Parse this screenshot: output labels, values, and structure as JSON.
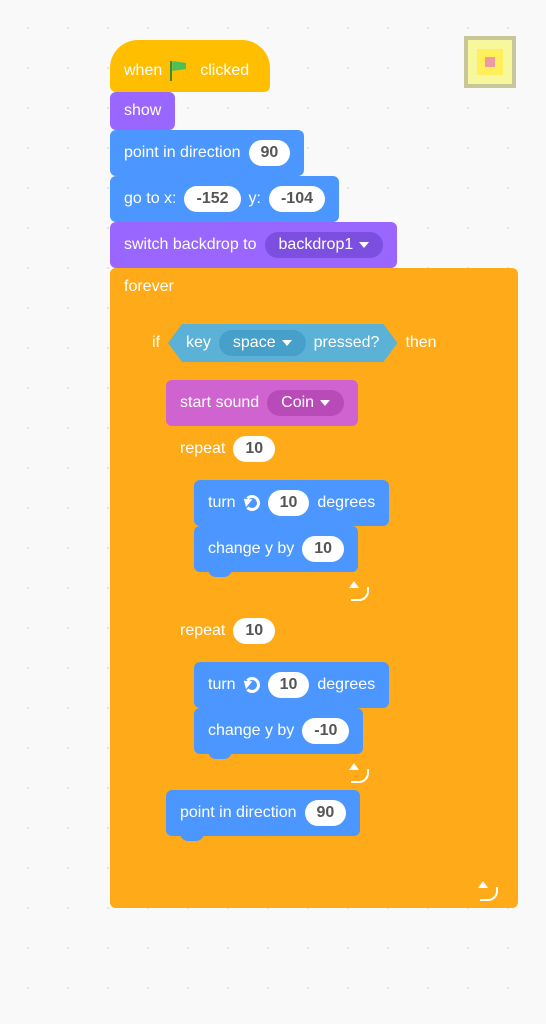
{
  "colors": {
    "events": "#ffbf00",
    "looks": "#9966ff",
    "motion": "#4c97ff",
    "control": "#ffab19",
    "sound": "#cf63cf",
    "sensing": "#5cb1d6"
  },
  "stop_button": {
    "name": "stop-button"
  },
  "script": {
    "hat": {
      "prefix": "when",
      "suffix": "clicked",
      "icon": "green-flag"
    },
    "show": {
      "label": "show"
    },
    "point1": {
      "label_pre": "point in direction",
      "value": "90"
    },
    "goto": {
      "label_pre": "go to x:",
      "x": "-152",
      "label_mid": "y:",
      "y": "-104"
    },
    "backdrop": {
      "label_pre": "switch backdrop to",
      "value": "backdrop1"
    },
    "forever": {
      "label": "forever"
    },
    "if": {
      "label_if": "if",
      "label_then": "then",
      "cond": {
        "pre": "key",
        "key": "space",
        "post": "pressed?"
      }
    },
    "sound": {
      "label_pre": "start sound",
      "value": "Coin"
    },
    "repeat1": {
      "label": "repeat",
      "count": "10",
      "turn": {
        "pre": "turn",
        "deg": "10",
        "post": "degrees"
      },
      "changeY": {
        "pre": "change y by",
        "val": "10"
      }
    },
    "repeat2": {
      "label": "repeat",
      "count": "10",
      "turn": {
        "pre": "turn",
        "deg": "10",
        "post": "degrees"
      },
      "changeY": {
        "pre": "change y by",
        "val": "-10"
      }
    },
    "point2": {
      "label_pre": "point in direction",
      "value": "90"
    }
  }
}
